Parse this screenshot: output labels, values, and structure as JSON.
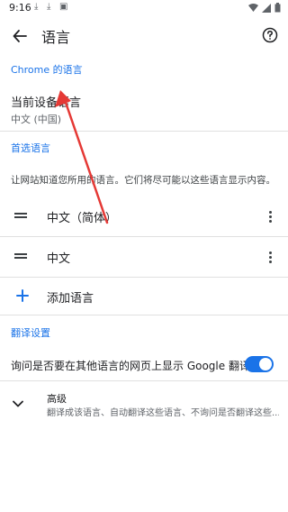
{
  "status_bar": {
    "time": "9:16",
    "icons": [
      "download-icon",
      "download-icon",
      "image-icon",
      "wifi-icon",
      "signal-icon",
      "battery-icon"
    ]
  },
  "app_bar": {
    "title": "语言",
    "back_icon": "arrow-back-icon",
    "help_icon": "help-icon"
  },
  "chrome_language": {
    "header": "Chrome 的语言",
    "current_device_language_title": "当前设备语言",
    "current_device_language_value": "中文 (中国)"
  },
  "preferred_languages": {
    "header": "首选语言",
    "description": "让网站知道您所用的语言。它们将尽可能以这些语言显示内容。",
    "items": [
      {
        "label": "中文（简体）"
      },
      {
        "label": "中文"
      }
    ],
    "add_label": "添加语言"
  },
  "translate_settings": {
    "header": "翻译设置",
    "offer_translate_label": "询问是否要在其他语言的网页上显示 Google 翻译",
    "offer_translate_enabled": true,
    "advanced_title": "高级",
    "advanced_subtitle": "翻译成该语言、自动翻译这些语言、不询问是否翻译这些..."
  },
  "colors": {
    "accent": "#1a73e8",
    "annotation_arrow": "#e53935"
  }
}
